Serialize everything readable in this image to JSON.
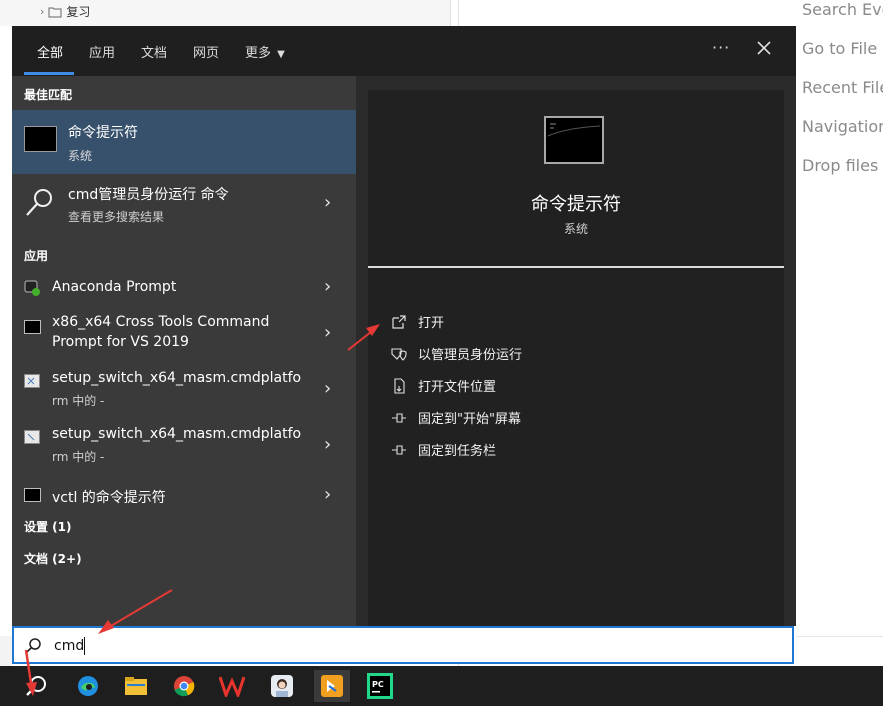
{
  "background": {
    "tree_item": "复习",
    "hints": [
      "Search Eve",
      "Go to File",
      "Recent File",
      "Navigation",
      "Drop files"
    ]
  },
  "tabs": [
    {
      "label": "全部",
      "active": true
    },
    {
      "label": "应用"
    },
    {
      "label": "文档"
    },
    {
      "label": "网页"
    },
    {
      "label": "更多"
    }
  ],
  "sections": {
    "best_match": "最佳匹配",
    "apps": "应用",
    "settings": "设置 (1)",
    "documents": "文档 (2+)"
  },
  "best_match": {
    "title": "命令提示符",
    "subtitle": "系统"
  },
  "web_search": {
    "title": "cmd管理员身份运行 命令",
    "subtitle": "查看更多搜索结果"
  },
  "apps": [
    {
      "line1": "Anaconda Prompt",
      "line2": ""
    },
    {
      "line1": "x86_x64 Cross Tools Command",
      "line2": "Prompt for VS 2019"
    },
    {
      "line1": "setup_switch_x64_masm.cmdplatfo",
      "line2": "rm 中的 -"
    },
    {
      "line1": "setup_switch_x64_masm.cmdplatfo",
      "line2": "rm 中的 -"
    },
    {
      "line1": "vctl 的命令提示符",
      "line2": ""
    }
  ],
  "preview": {
    "title": "命令提示符",
    "subtitle": "系统"
  },
  "actions": [
    {
      "label": "打开",
      "icon": "open-icon"
    },
    {
      "label": "以管理员身份运行",
      "icon": "shield-icon"
    },
    {
      "label": "打开文件位置",
      "icon": "file-location-icon"
    },
    {
      "label": "固定到\"开始\"屏幕",
      "icon": "pin-icon"
    },
    {
      "label": "固定到任务栏",
      "icon": "pin-icon"
    }
  ],
  "search": {
    "value": "cmd"
  },
  "colors": {
    "accent": "#1e78d4",
    "selected": "#37506c",
    "annotation": "#e53935"
  },
  "taskbar": [
    "search-icon",
    "edge-icon",
    "file-explorer-icon",
    "chrome-icon",
    "wps-icon",
    "avatar-app-icon",
    "feishu-icon",
    "pycharm-icon"
  ]
}
